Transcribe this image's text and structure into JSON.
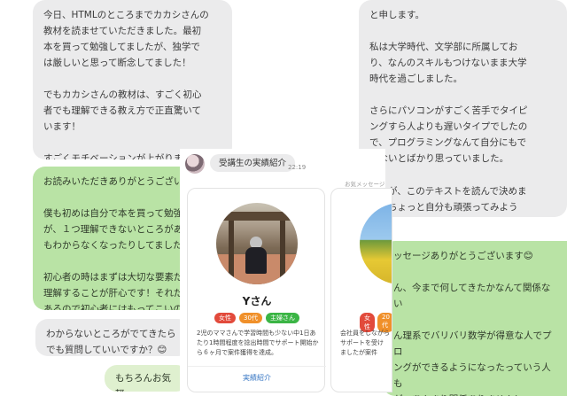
{
  "left_column": {
    "message_1": "今日、HTMLのところまでカカシさんの\n教材を読ませていただきました。最初\n本を買って勉強してましたが、独学で\nは厳しいと思って断念してました！\n\nでもカカシさんの教材は、すごく初心\n者でも理解できる教え方で正直驚いて\nいます！\n\nすごくモチベーションが上がりまし\nた！頑張ります！",
    "message_2": "お読みいただきありがとうござい\n\n僕も初めは自分で本を買って勉強\nが、１つ理解できないところがあ\nもわからなくなったりしてました\n\n初心者の時はまずは大切な要素だ\n理解することが肝心です！それだ\nあるので初心者にはもってこいの\nってると思います！🔥",
    "message_3": "わからないところがでてきたら\nでも質問していいですか？😊",
    "message_4": "もちろんお気軽"
  },
  "right_column": {
    "message_1": "と申します。\n\n私は大学時代、文学部に所属してお\nり、なんのスキルもつけないまま大学\n時代を過ごしました。\n\nさらにパソコンがすごく苦手でタイピ\nングすら人よりも遅いタイプでしたの\nで、プログラミングなんて自分にもで\nきないとばかり思っていました。\n\nですが、このテキストを読んで決めま\nた、ちょっと自分も頑張ってみよう\n\n\nで何にもしてきてない自分を変え\nです。どうかよろしくお願いしま",
    "message_2": "ッセージありがとうございます😊\n\nん、今まで何してきたかなんて関係ない\n\nん理系でバリバリ数学が得意な人でプロ\nングができるようになったっていう人も\nが、あんまり関係ありません！\n\nも高卒でもできるようになった人はたく\nしますので、これが山崎さんの人生を変"
  },
  "line_panel": {
    "label": "受講生の実績紹介",
    "time": "22:19",
    "message_link": "お気メッセージ",
    "card": {
      "name": "Yさん",
      "tags": [
        "女性",
        "30代",
        "主婦さん"
      ],
      "description": "2児のママさんで学習時間も少ない中1日あ\nたり1時間程度を捻出時間でサポート開始か\nら６ヶ月で案件獲得を達成。",
      "link": "実績紹介"
    },
    "card_partial": {
      "tags": [
        "女性",
        "20代"
      ],
      "description": "会社員をしながら\nサポートを受け\nましたが案件"
    }
  },
  "colors": {
    "gray_bubble": "#ebebec",
    "green_bubble": "#b9e3a5",
    "light_green_bubble": "#dff0cf",
    "tag_red": "#e24a3b",
    "tag_orange": "#f0902a",
    "tag_green": "#3bb545",
    "link_blue": "#3a78c4"
  }
}
